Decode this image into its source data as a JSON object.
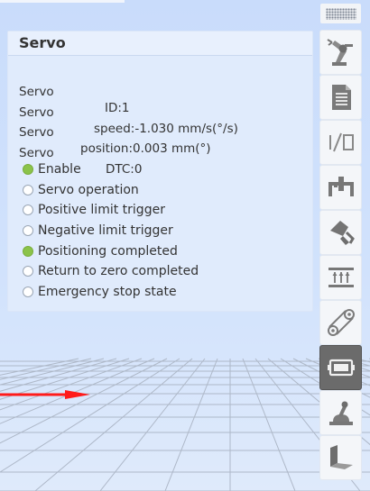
{
  "panel": {
    "title": "Servo",
    "rows": [
      {
        "label": "Servo",
        "value": "ID:1"
      },
      {
        "label": "Servo",
        "value": "speed:-1.030 mm/s(°/s)"
      },
      {
        "label": "Servo",
        "value": "position:0.003 mm(°)"
      },
      {
        "label": "Servo",
        "value": "DTC:0"
      }
    ],
    "statuses": [
      {
        "label": "Enable",
        "active": true
      },
      {
        "label": "Servo operation",
        "active": false
      },
      {
        "label": "Positive limit trigger",
        "active": false
      },
      {
        "label": "Negative limit trigger",
        "active": false
      },
      {
        "label": "Positioning completed",
        "active": true
      },
      {
        "label": "Return to zero completed",
        "active": false
      },
      {
        "label": "Emergency stop state",
        "active": false
      }
    ]
  },
  "toolbar": {
    "selected": "servo-icon",
    "buttons": [
      "robot-arm-icon",
      "document-icon",
      "io-icon",
      "gripper-icon",
      "vacuum-icon",
      "conveyor-icon",
      "belt-icon",
      "servo-icon",
      "joystick-icon",
      "workpiece-icon"
    ]
  },
  "colors": {
    "status_on": "#8bc34a",
    "axis_x": "#ff1a1a",
    "toolbar_active": "#6b6b6b",
    "background": "#d1e2fc"
  }
}
